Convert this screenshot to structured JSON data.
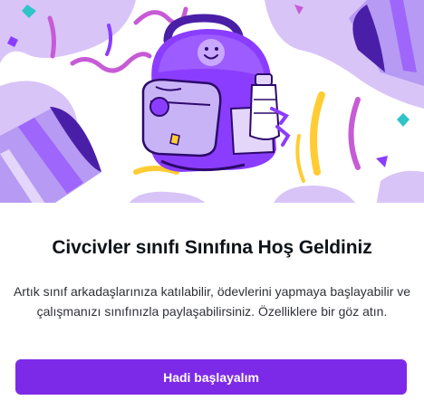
{
  "dialog": {
    "title": "Civcivler sınıfı Sınıfına Hoş Geldiniz",
    "description": "Artık sınıf arkadaşlarınıza katılabilir, ödevlerini yapmaya başlayabilir ve çalışmanızı sınıfınızla paylaşabilirsiniz. Özelliklere bir göz atın.",
    "primary_button_label": "Hadi başlayalım"
  },
  "illustration": {
    "subject": "backpack-with-confetti",
    "icons": [
      "backpack-icon",
      "party-popper-icon",
      "confetti-icon",
      "smiley-face-icon",
      "water-bottle-icon"
    ]
  },
  "colors": {
    "accent": "#7d2ae8",
    "title_text": "#0e1318",
    "body_text": "#2f3137",
    "lavender": "#d9c4f8",
    "purple": "#8b3dff",
    "pink": "#c75bd6",
    "yellow": "#ffcc33",
    "teal": "#2fc4c7"
  }
}
